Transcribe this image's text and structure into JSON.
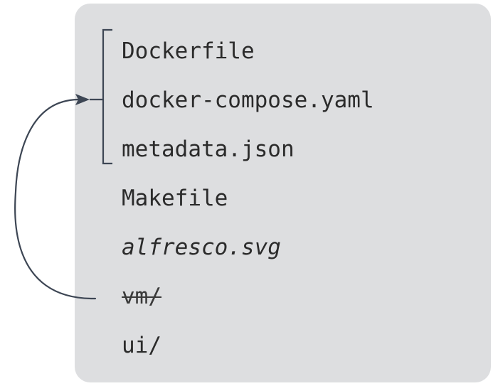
{
  "files": [
    {
      "name": "Dockerfile",
      "style": "normal"
    },
    {
      "name": "docker-compose.yaml",
      "style": "normal"
    },
    {
      "name": "metadata.json",
      "style": "normal"
    },
    {
      "name": "Makefile",
      "style": "normal"
    },
    {
      "name": "alfresco.svg",
      "style": "italic"
    },
    {
      "name": "vm/",
      "style": "strikethrough"
    },
    {
      "name": "ui/",
      "style": "normal"
    }
  ],
  "diagram": {
    "group_bracket_covers": [
      "Dockerfile",
      "docker-compose.yaml",
      "metadata.json"
    ],
    "arrow_from": "vm/",
    "arrow_to": "group_bracket",
    "colors": {
      "panel": "#dddee0",
      "text": "#2b2b2b",
      "connector": "#3d4654"
    }
  }
}
